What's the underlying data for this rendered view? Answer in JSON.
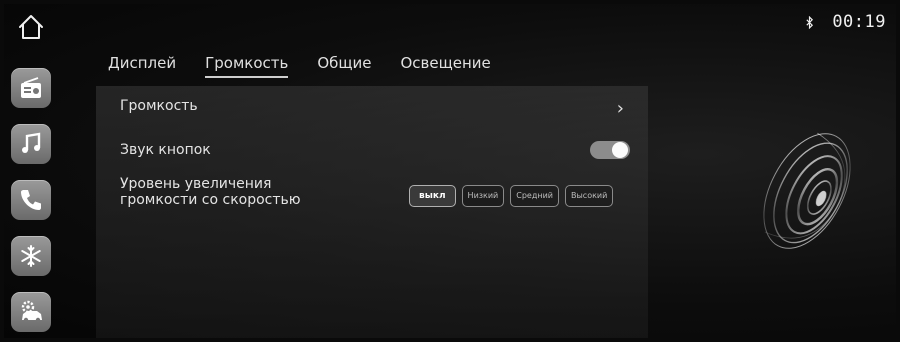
{
  "status": {
    "bluetooth_icon": "bluetooth-icon",
    "time": "00:19"
  },
  "sidebar": {
    "home_icon": "home-icon",
    "items": [
      {
        "name": "radio",
        "icon": "radio-icon"
      },
      {
        "name": "music",
        "icon": "music-note-icon"
      },
      {
        "name": "phone",
        "icon": "phone-icon"
      },
      {
        "name": "climate",
        "icon": "snowflake-icon"
      },
      {
        "name": "vehicle-settings",
        "icon": "car-gear-icon"
      }
    ]
  },
  "tabs": [
    {
      "label": "Дисплей",
      "active": false
    },
    {
      "label": "Громкость",
      "active": true
    },
    {
      "label": "Общие",
      "active": false
    },
    {
      "label": "Освещение",
      "active": false
    }
  ],
  "settings": {
    "volume_label": "Громкость",
    "key_sound_label": "Звук кнопок",
    "key_sound_on": true,
    "speed_volume_label_line1": "Уровень увеличения",
    "speed_volume_label_line2": "громкости со скоростью",
    "speed_volume_options": [
      "выкл",
      "Низкий",
      "Средний",
      "Высокий"
    ],
    "speed_volume_selected": "выкл"
  },
  "colors": {
    "accent": "#cfcfcf",
    "background": "#0a0a0a",
    "icon_tile": "#7f7f7f"
  }
}
